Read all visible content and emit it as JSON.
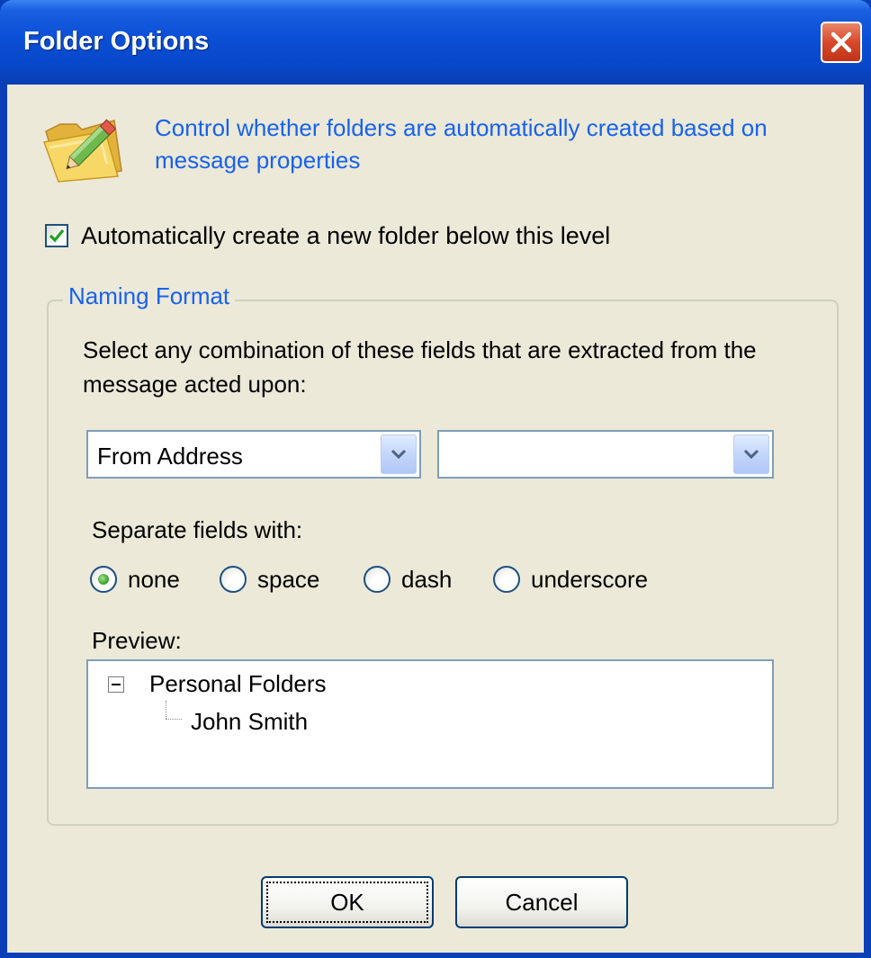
{
  "window": {
    "title": "Folder Options",
    "close_icon": "close-icon"
  },
  "header": {
    "icon": "folder-edit-icon",
    "description": "Control whether folders are automatically created based on message properties"
  },
  "auto_create": {
    "label": "Automatically create a new folder below this level",
    "checked": true
  },
  "naming_format": {
    "legend": "Naming Format",
    "instructions": "Select any combination of these fields that are extracted from the message acted upon:",
    "field1": {
      "value": "From Address"
    },
    "field2": {
      "value": ""
    },
    "separator_label": "Separate fields with:",
    "separator_options": [
      {
        "label": "none",
        "selected": true
      },
      {
        "label": "space",
        "selected": false
      },
      {
        "label": "dash",
        "selected": false
      },
      {
        "label": "underscore",
        "selected": false
      }
    ],
    "preview_label": "Preview:",
    "preview_tree": {
      "root": "Personal Folders",
      "child": "John Smith"
    }
  },
  "buttons": {
    "ok": "OK",
    "cancel": "Cancel"
  },
  "colors": {
    "title_blue": "#0a4fd6",
    "link_blue": "#1762f0",
    "dialog_bg": "#ece9d8",
    "close_red": "#d8482a"
  }
}
